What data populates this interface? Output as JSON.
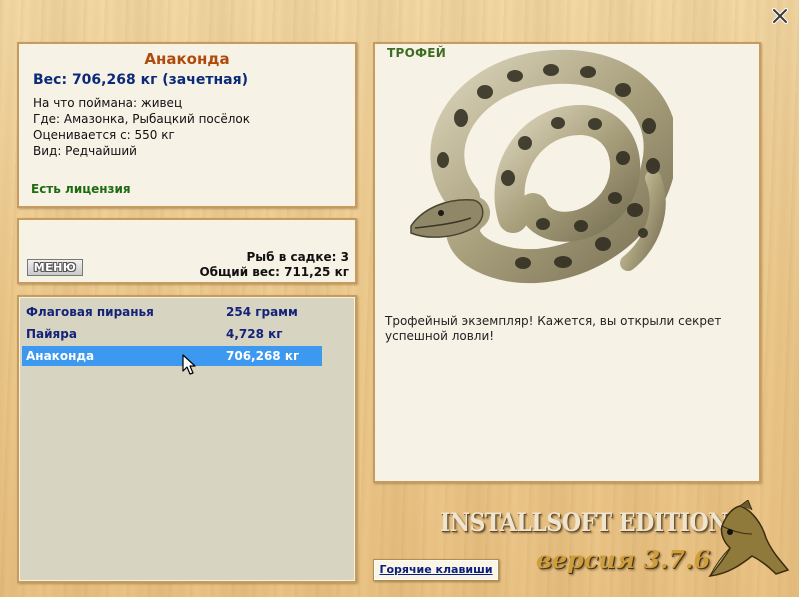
{
  "catch": {
    "name": "Анаконда",
    "weight": "Вес: 706,268 кг (зачетная)",
    "bait": "На что поймана: живец",
    "place": "Где: Амазонка, Рыбацкий посёлок",
    "value": "Оценивается с: 550 кг",
    "kind": "Вид: Редчайший",
    "license": "Есть лицензия"
  },
  "cage": {
    "menu_label": "МЕНЮ",
    "count": "Рыб в садке: 3",
    "total": "Общий вес: 711,25 кг"
  },
  "fish_list": [
    {
      "name": "Флаговая пиранья",
      "weight": "254 грамм",
      "selected": false
    },
    {
      "name": "Пайяра",
      "weight": "4,728 кг",
      "selected": false
    },
    {
      "name": "Анаконда",
      "weight": "706,268 кг",
      "selected": true
    }
  ],
  "trophy": {
    "label": "ТРОФЕЙ",
    "text": "Трофейный экземпляр! Кажется, вы открыли секрет успешной ловли!"
  },
  "footer": {
    "hotkeys": "Горячие клавиши",
    "brand": "INSTALLSOFT EDITION",
    "version": "версия 3.7.6"
  },
  "colors": {
    "title": "#b04a0c",
    "weight": "#0b2a7a",
    "license": "#1f6b12",
    "selection": "#3d99f0"
  }
}
